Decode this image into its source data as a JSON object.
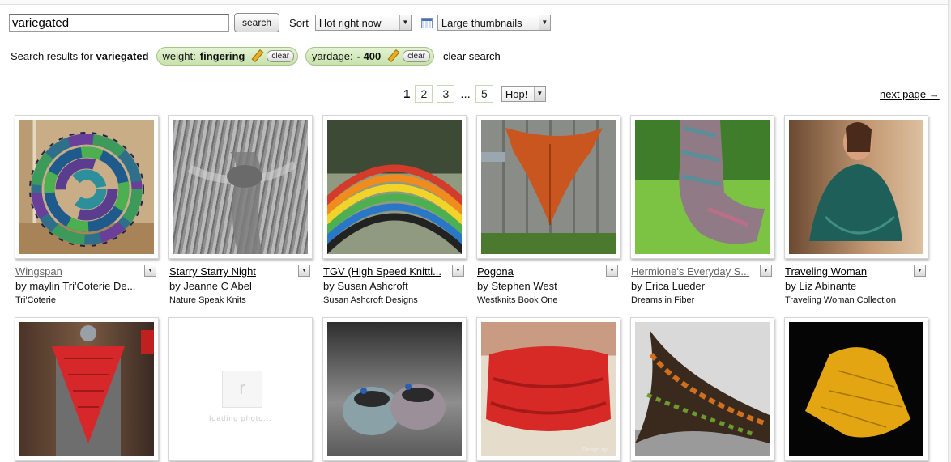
{
  "search": {
    "query": "variegated",
    "button_label": "search",
    "sort_label": "Sort",
    "sort_value": "Hot right now",
    "view_value": "Large thumbnails"
  },
  "filters": {
    "results_prefix": "Search results for",
    "results_term": "variegated",
    "pills": [
      {
        "key": "weight:",
        "value": "fingering",
        "clear_label": "clear"
      },
      {
        "key": "yardage:",
        "value": "- 400",
        "clear_label": "clear"
      }
    ],
    "clear_search_label": "clear search"
  },
  "pagination": {
    "current": "1",
    "pages": [
      "2",
      "3"
    ],
    "ellipsis": "...",
    "last": "5",
    "hop_label": "Hop!",
    "next_label": "next page →"
  },
  "loading_label": "loading photo...",
  "results": [
    {
      "title": "Wingspan",
      "author": "by maylin Tri'Coterie De...",
      "source": "Tri'Coterie",
      "visited": true,
      "photo": "wingspan-spiral-shawl"
    },
    {
      "title": "Starry Starry Night",
      "author": "by Jeanne C Abel",
      "source": "Nature Speak Knits",
      "visited": false,
      "photo": "grey-lace-wrap"
    },
    {
      "title": "TGV (High Speed Knitti...",
      "author": "by Susan Ashcroft",
      "source": "Susan Ashcroft Designs",
      "visited": false,
      "photo": "rainbow-shawl"
    },
    {
      "title": "Pogona",
      "author": "by Stephen West",
      "source": "Westknits Book One",
      "visited": false,
      "photo": "orange-shawl-on-fence"
    },
    {
      "title": "Hermione's Everyday S...",
      "author": "by Erica Lueder",
      "source": "Dreams in Fiber",
      "visited": true,
      "photo": "sock-on-grass"
    },
    {
      "title": "Traveling Woman",
      "author": "by Liz Abinante",
      "source": "Traveling Woman Collection",
      "visited": false,
      "photo": "teal-shawl-on-woman"
    },
    {
      "photo": "red-lace-kerchief-on-dress-form"
    },
    {
      "photo": "loading-placeholder"
    },
    {
      "photo": "baby-booties"
    },
    {
      "photo": "red-cowl",
      "watermark": "Design by ·"
    },
    {
      "photo": "crescent-shawl-on-wall"
    },
    {
      "photo": "yellow-lace-shawl"
    }
  ],
  "colors": {
    "pill_green": "#c8e2ad",
    "pill_border": "#a6c38a",
    "page_border": "#c7d9b7"
  }
}
